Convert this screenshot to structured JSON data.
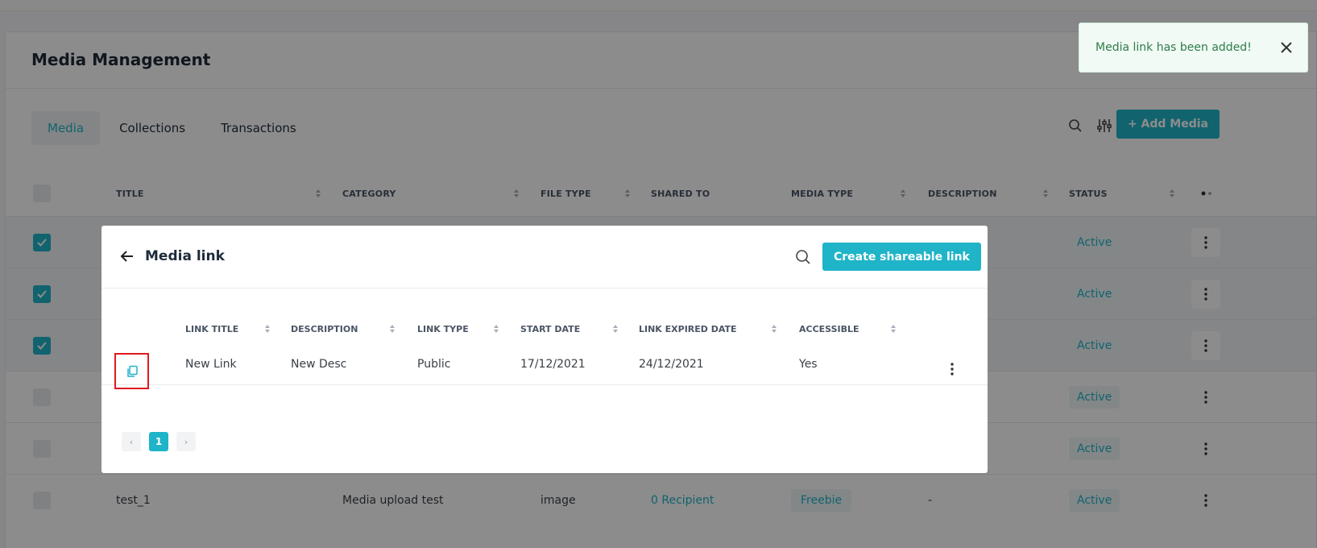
{
  "page": {
    "title": "Media Management",
    "tabs": [
      {
        "label": "Media",
        "active": true
      },
      {
        "label": "Collections",
        "active": false
      },
      {
        "label": "Transactions",
        "active": false
      }
    ],
    "add_button": "+ Add Media",
    "columns": [
      "TITLE",
      "CATEGORY",
      "FILE TYPE",
      "SHARED TO",
      "MEDIA TYPE",
      "DESCRIPTION",
      "STATUS"
    ],
    "rows": [
      {
        "checked": true,
        "status": "Active"
      },
      {
        "checked": true,
        "status": "Active"
      },
      {
        "checked": true,
        "status": "Active"
      },
      {
        "checked": false,
        "status": "Active"
      },
      {
        "checked": false,
        "status": "Active"
      },
      {
        "checked": false,
        "title": "test_1",
        "category": "Media upload test",
        "file_type": "image",
        "shared_to": "0 Recipient",
        "media_type": "Freebie",
        "description": "-",
        "status": "Active"
      }
    ]
  },
  "toast": {
    "message": "Media link has been added!"
  },
  "modal": {
    "title": "Media link",
    "create_button": "Create shareable link",
    "columns": [
      "LINK TITLE",
      "DESCRIPTION",
      "LINK TYPE",
      "START DATE",
      "LINK EXPIRED DATE",
      "ACCESSIBLE"
    ],
    "rows": [
      {
        "link_title": "New Link",
        "description": "New Desc",
        "link_type": "Public",
        "start_date": "17/12/2021",
        "expired_date": "24/12/2021",
        "accessible": "Yes"
      }
    ],
    "pagination": {
      "current": "1",
      "prev": "‹",
      "next": "›"
    }
  },
  "colors": {
    "accent": "#1fb4c8",
    "toast_bg": "#f1faf4",
    "highlight": "#e0191e"
  }
}
